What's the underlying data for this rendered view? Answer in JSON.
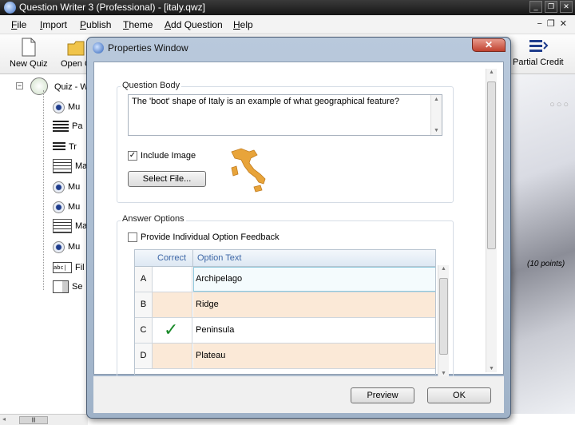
{
  "app": {
    "title": "Question Writer 3 (Professional) - [italy.qwz]"
  },
  "menu": [
    "File",
    "Import",
    "Publish",
    "Theme",
    "Add Question",
    "Help"
  ],
  "toolbar": {
    "new_quiz": "New Quiz",
    "open": "Open Q",
    "partial_credit": "Partial Credit"
  },
  "tree": {
    "root_label": "Quiz - Wh",
    "items": [
      "Mu",
      "Pa",
      "Tr",
      "Ma",
      "Mu",
      "Mu",
      "Ma",
      "Mu",
      "Fil",
      "Se"
    ]
  },
  "background": {
    "points_label": "(10 points)",
    "dots": "○○○"
  },
  "dialog": {
    "title": "Properties Window",
    "close": "✕",
    "question_body_label": "Question Body",
    "question_text": "The 'boot' shape of Italy is an example of what geographical feature?",
    "include_image_label": "Include Image",
    "include_image_checked": true,
    "select_file_label": "Select File...",
    "answer_options_label": "Answer Options",
    "feedback_label": "Provide Individual Option Feedback",
    "feedback_checked": false,
    "columns": {
      "correct": "Correct",
      "text": "Option Text"
    },
    "answers": [
      {
        "letter": "A",
        "text": "Archipelago",
        "correct": false
      },
      {
        "letter": "B",
        "text": "Ridge",
        "correct": false
      },
      {
        "letter": "C",
        "text": "Peninsula",
        "correct": true
      },
      {
        "letter": "D",
        "text": "Plateau",
        "correct": false
      }
    ],
    "preview_label": "Preview",
    "ok_label": "OK"
  },
  "colors": {
    "accent": "#3c66a6",
    "correct_tick": "#1a8a2a",
    "row_shade": "#fbe9d7",
    "italy": "#e8a43a"
  }
}
